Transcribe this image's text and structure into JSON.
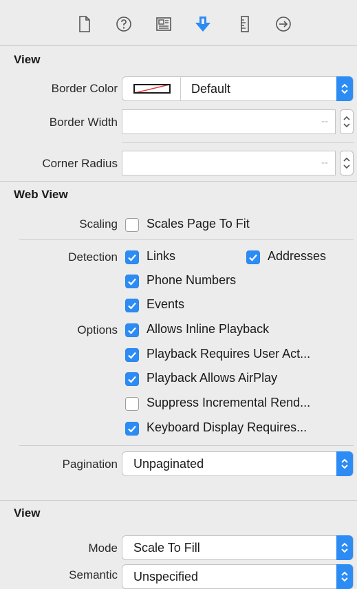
{
  "toolbar": {
    "icons": [
      "file-inspector-icon",
      "quick-help-icon",
      "identity-inspector-icon",
      "attributes-inspector-icon",
      "size-inspector-icon",
      "connections-inspector-icon"
    ],
    "selected": "attributes-inspector-icon",
    "accent": "#2c8cf4"
  },
  "view_section": {
    "title": "View",
    "border_color": {
      "label": "Border Color",
      "value": "Default"
    },
    "border_width": {
      "label": "Border Width",
      "placeholder": "--"
    },
    "corner_radius": {
      "label": "Corner Radius",
      "placeholder": "--"
    }
  },
  "web_view": {
    "title": "Web View",
    "scaling": {
      "label": "Scaling",
      "option": "Scales Page To Fit",
      "checked": false
    },
    "detection": {
      "label": "Detection",
      "links": {
        "label": "Links",
        "checked": true
      },
      "addresses": {
        "label": "Addresses",
        "checked": true
      },
      "phone_numbers": {
        "label": "Phone Numbers",
        "checked": true
      },
      "events": {
        "label": "Events",
        "checked": true
      }
    },
    "options": {
      "label": "Options",
      "inline_playback": {
        "label": "Allows Inline Playback",
        "checked": true
      },
      "requires_user_action": {
        "label": "Playback Requires User Act...",
        "checked": true
      },
      "allows_airplay": {
        "label": "Playback Allows AirPlay",
        "checked": true
      },
      "suppress_incremental": {
        "label": "Suppress Incremental Rend...",
        "checked": false
      },
      "keyboard_display": {
        "label": "Keyboard Display Requires...",
        "checked": true
      }
    },
    "pagination": {
      "label": "Pagination",
      "value": "Unpaginated"
    }
  },
  "view_section_2": {
    "title": "View",
    "mode": {
      "label": "Mode",
      "value": "Scale To Fill"
    },
    "semantic": {
      "label": "Semantic",
      "value": "Unspecified"
    }
  }
}
